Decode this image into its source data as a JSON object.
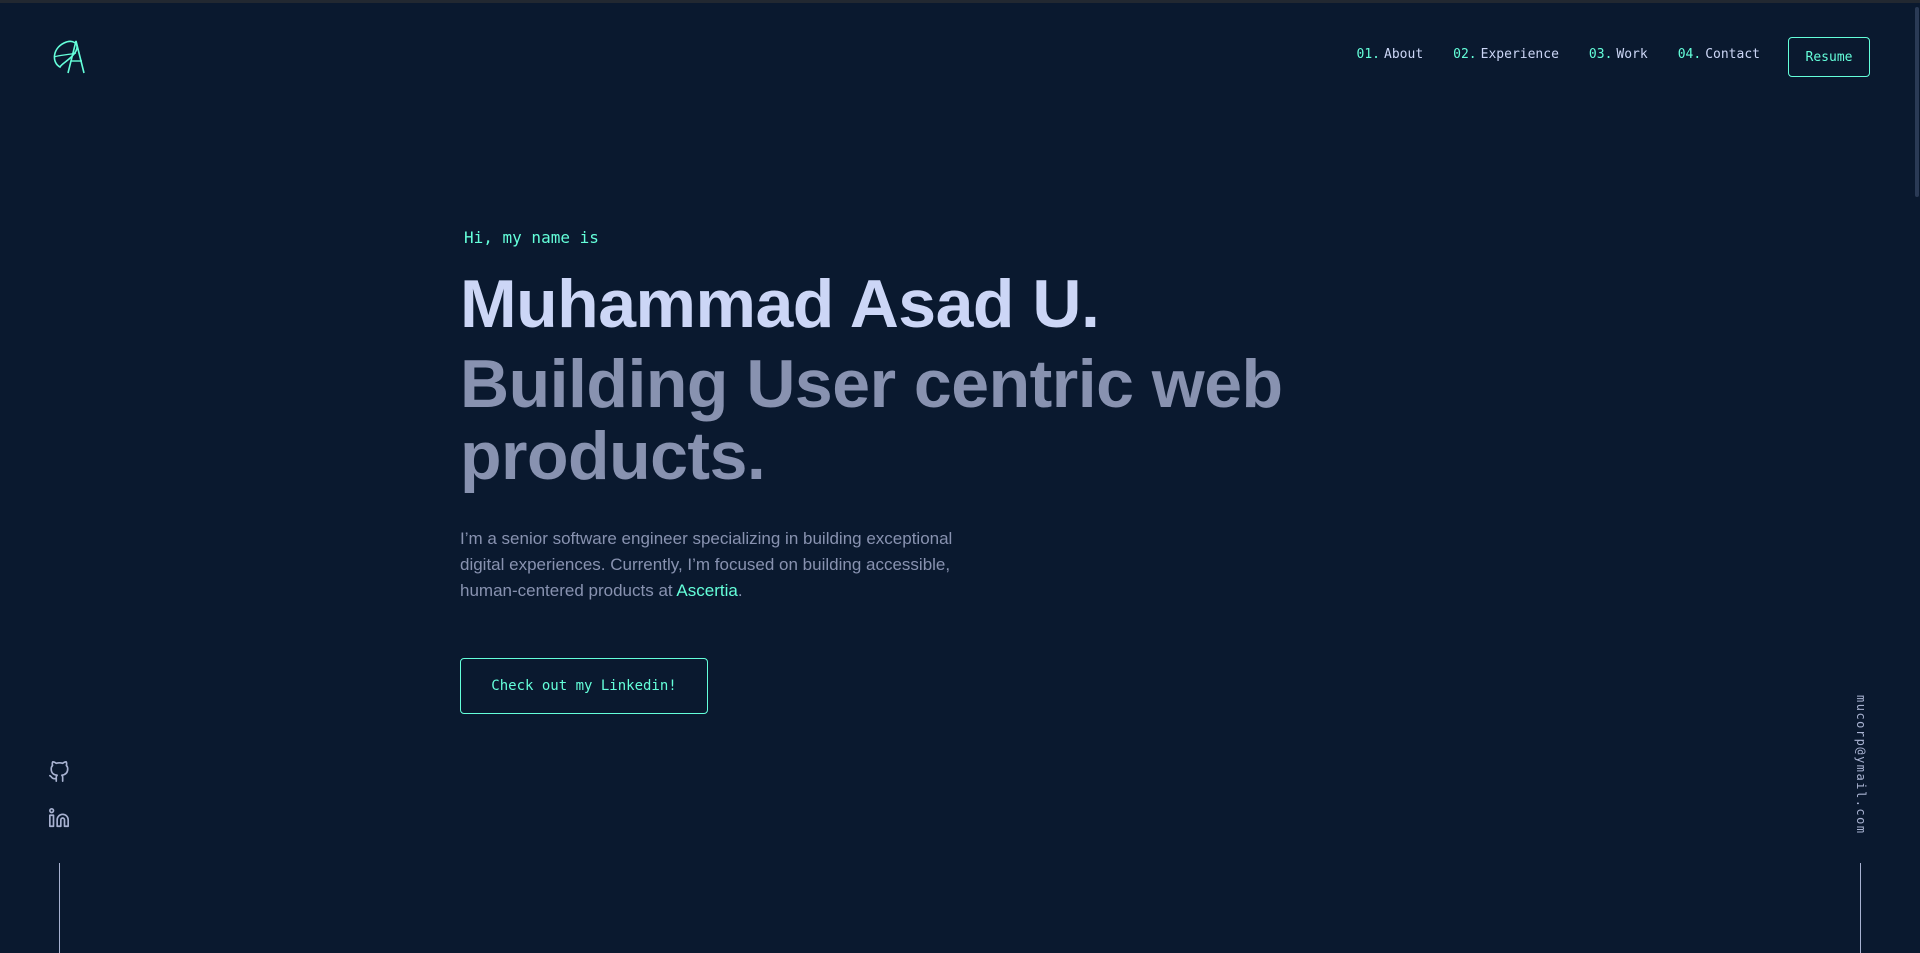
{
  "logo": {
    "letter": "A",
    "accent": "#64ffda"
  },
  "nav": {
    "items": [
      {
        "num": "01.",
        "label": "About"
      },
      {
        "num": "02.",
        "label": "Experience"
      },
      {
        "num": "03.",
        "label": "Work"
      },
      {
        "num": "04.",
        "label": "Contact"
      }
    ],
    "resume_label": "Resume"
  },
  "hero": {
    "greeting": "Hi, my name is",
    "name": "Muhammad Asad U.",
    "tagline": "Building User centric web products.",
    "bio_prefix": "I’m a senior software engineer specializing in building exceptional digital experiences. Currently, I’m focused on building accessible, human-centered products at ",
    "bio_link": "Ascertia",
    "bio_suffix": ".",
    "cta_label": "Check out my Linkedin!"
  },
  "socials": {
    "icons": [
      "github-icon",
      "linkedin-icon"
    ]
  },
  "email": "mucorp@ymail.com",
  "colors": {
    "background": "#0a192f",
    "accent": "#64ffda",
    "heading": "#ccd6f6",
    "text": "#8892b0"
  }
}
